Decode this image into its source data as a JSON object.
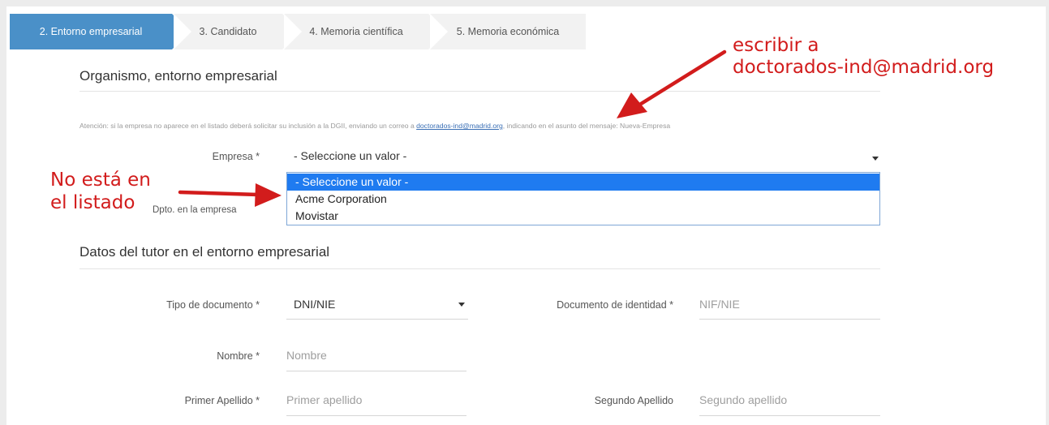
{
  "steps": [
    {
      "label": "2. Entorno empresarial",
      "active": true
    },
    {
      "label": "3. Candidato",
      "active": false
    },
    {
      "label": "4. Memoria científica",
      "active": false
    },
    {
      "label": "5. Memoria económica",
      "active": false
    }
  ],
  "section1": {
    "title": "Organismo, entorno empresarial"
  },
  "notice": {
    "before": "Atención: si la empresa no aparece en el listado deberá solicitar su inclusión a la DGII, enviando un correo a ",
    "email": "doctorados-ind@madrid.org",
    "after": ", indicando en el asunto del mensaje: Nueva-Empresa"
  },
  "empresa": {
    "label": "Empresa *",
    "value": "- Seleccione un valor -",
    "options": [
      "- Seleccione un valor -",
      "Acme Corporation",
      "Movistar"
    ]
  },
  "dpto": {
    "label": "Dpto. en la empresa"
  },
  "section2": {
    "title": "Datos del tutor en el entorno empresarial"
  },
  "tipo_doc": {
    "label": "Tipo de documento *",
    "value": "DNI/NIE"
  },
  "doc_id": {
    "label": "Documento de identidad *",
    "placeholder": "NIF/NIE"
  },
  "nombre": {
    "label": "Nombre *",
    "placeholder": "Nombre"
  },
  "apellido1": {
    "label": "Primer Apellido *",
    "placeholder": "Primer apellido"
  },
  "apellido2": {
    "label": "Segundo Apellido",
    "placeholder": "Segundo apellido"
  },
  "annotations": {
    "email_note_line1": "escribir a",
    "email_note_line2": "doctorados-ind@madrid.org",
    "list_note_line1": "No está en",
    "list_note_line2": "el listado"
  },
  "colors": {
    "accent": "#4a90c8",
    "annotation": "#d21c1c",
    "selected_option": "#1f7bf0"
  }
}
